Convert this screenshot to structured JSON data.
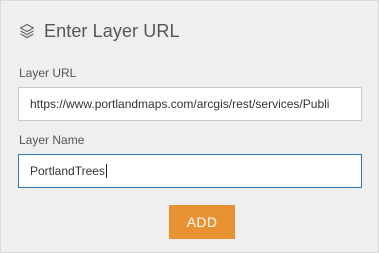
{
  "header": {
    "icon": "layers-icon",
    "title": "Enter Layer URL"
  },
  "form": {
    "url_label": "Layer URL",
    "url_value": "https://www.portlandmaps.com/arcgis/rest/services/Publi",
    "name_label": "Layer Name",
    "name_value": "PortlandTrees",
    "add_label": "ADD"
  },
  "colors": {
    "panel_bg": "#efefef",
    "focus_border": "#2b78b7",
    "button_bg": "#e99232"
  }
}
